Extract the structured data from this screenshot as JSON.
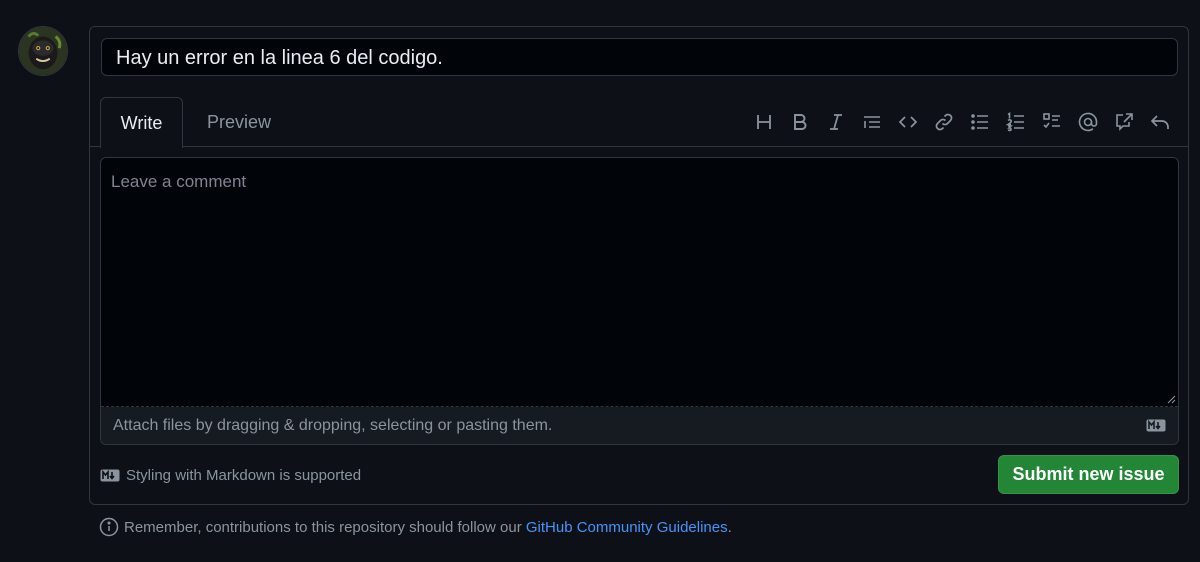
{
  "issue": {
    "title_value": "Hay un error en la linea 6 del codigo."
  },
  "tabs": [
    {
      "label": "Write",
      "active": true
    },
    {
      "label": "Preview",
      "active": false
    }
  ],
  "toolbar": [
    {
      "icon": "heading-icon"
    },
    {
      "icon": "bold-icon"
    },
    {
      "icon": "italic-icon"
    },
    {
      "icon": "quote-icon"
    },
    {
      "icon": "code-icon"
    },
    {
      "icon": "link-icon"
    },
    {
      "icon": "unordered-list-icon"
    },
    {
      "icon": "ordered-list-icon"
    },
    {
      "icon": "task-list-icon"
    },
    {
      "icon": "mention-icon"
    },
    {
      "icon": "cross-reference-icon"
    },
    {
      "icon": "reply-icon"
    }
  ],
  "editor": {
    "placeholder": "Leave a comment",
    "attach_text": "Attach files by dragging & dropping, selecting or pasting them."
  },
  "footer": {
    "markdown_note": "Styling with Markdown is supported",
    "submit_label": "Submit new issue"
  },
  "notice": {
    "prefix": "Remember, contributions to this repository should follow our ",
    "link": "GitHub Community Guidelines",
    "suffix": "."
  },
  "colors": {
    "background": "#0d1117",
    "border": "#30363d",
    "submit_green": "#238636",
    "link_blue": "#4493f8"
  }
}
